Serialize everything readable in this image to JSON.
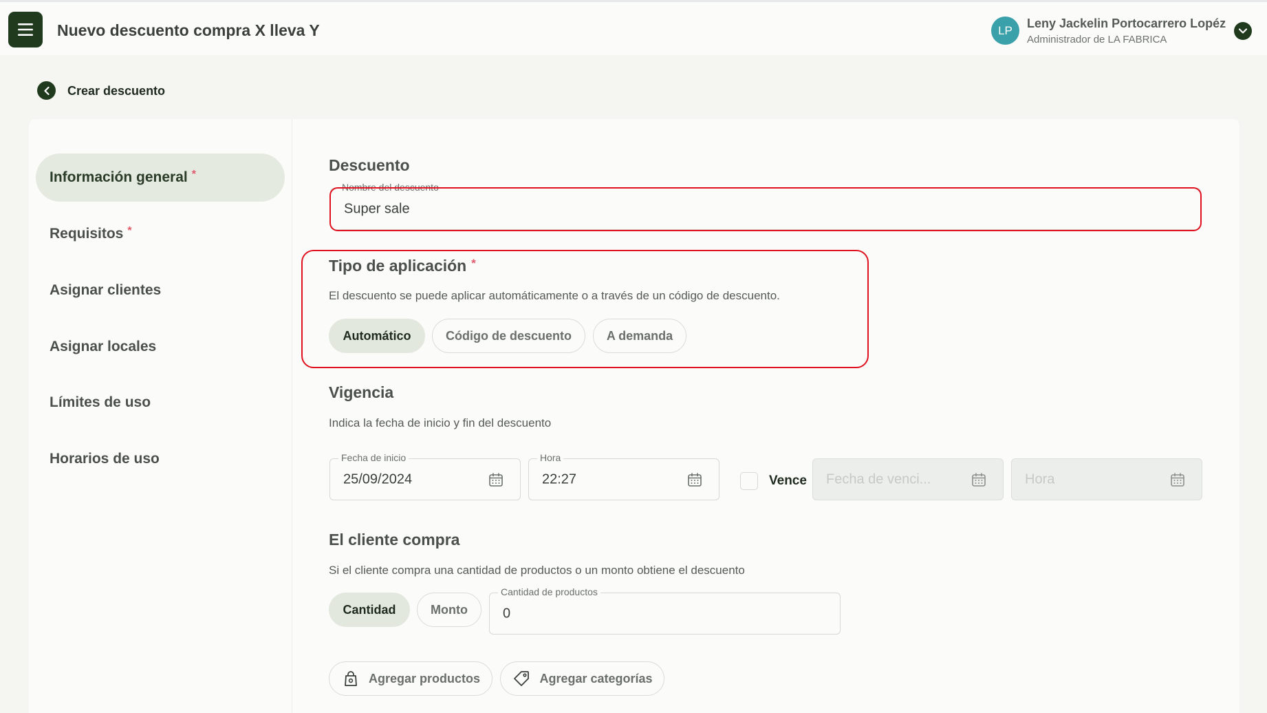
{
  "header": {
    "title": "Nuevo descuento compra X lleva Y",
    "user": {
      "initials": "LP",
      "name": "Leny Jackelin Portocarrero Lopéz",
      "role": "Administrador de LA FABRICA"
    }
  },
  "back": {
    "label": "Crear descuento"
  },
  "sidebar": {
    "items": [
      {
        "label": "Información general",
        "required": "*",
        "active": true
      },
      {
        "label": "Requisitos",
        "required": "*"
      },
      {
        "label": "Asignar clientes"
      },
      {
        "label": "Asignar locales"
      },
      {
        "label": "Límites de uso"
      },
      {
        "label": "Horarios de uso"
      }
    ]
  },
  "descuento": {
    "title": "Descuento",
    "name_label": "Nombre del descuento",
    "name_value": "Super sale"
  },
  "tipo": {
    "title": "Tipo de aplicación",
    "required": "*",
    "description": "El descuento se puede aplicar automáticamente o a través de un código de descuento.",
    "options": [
      "Automático",
      "Código de descuento",
      "A demanda"
    ],
    "selected": "Automático"
  },
  "vigencia": {
    "title": "Vigencia",
    "description": "Indica la fecha de inicio y fin del descuento",
    "start_date_label": "Fecha de inicio",
    "start_date_value": "25/09/2024",
    "start_time_label": "Hora",
    "start_time_value": "22:27",
    "expires_label": "Vence",
    "end_date_placeholder": "Fecha de venci...",
    "end_time_placeholder": "Hora"
  },
  "cliente_compra": {
    "title": "El cliente compra",
    "description": "Si el cliente compra una cantidad de productos o un monto obtiene el descuento",
    "options": [
      "Cantidad",
      "Monto"
    ],
    "selected": "Cantidad",
    "qty_label": "Cantidad de productos",
    "qty_value": "0",
    "add_products_label": "Agregar productos",
    "add_categories_label": "Agregar categorías"
  },
  "colors": {
    "brand_dark_green": "#1f3a1d",
    "selected_pill": "#e3e8df",
    "avatar": "#3aa0aa",
    "required": "#e05a6a",
    "highlight_red": "#e0101e"
  },
  "icons": {
    "menu": "hamburger-menu-icon",
    "user_menu": "chevron-down-icon",
    "back": "chevron-left-icon",
    "calendar": "calendar-icon",
    "products": "shopping-bag-icon",
    "categories": "tag-icon"
  }
}
